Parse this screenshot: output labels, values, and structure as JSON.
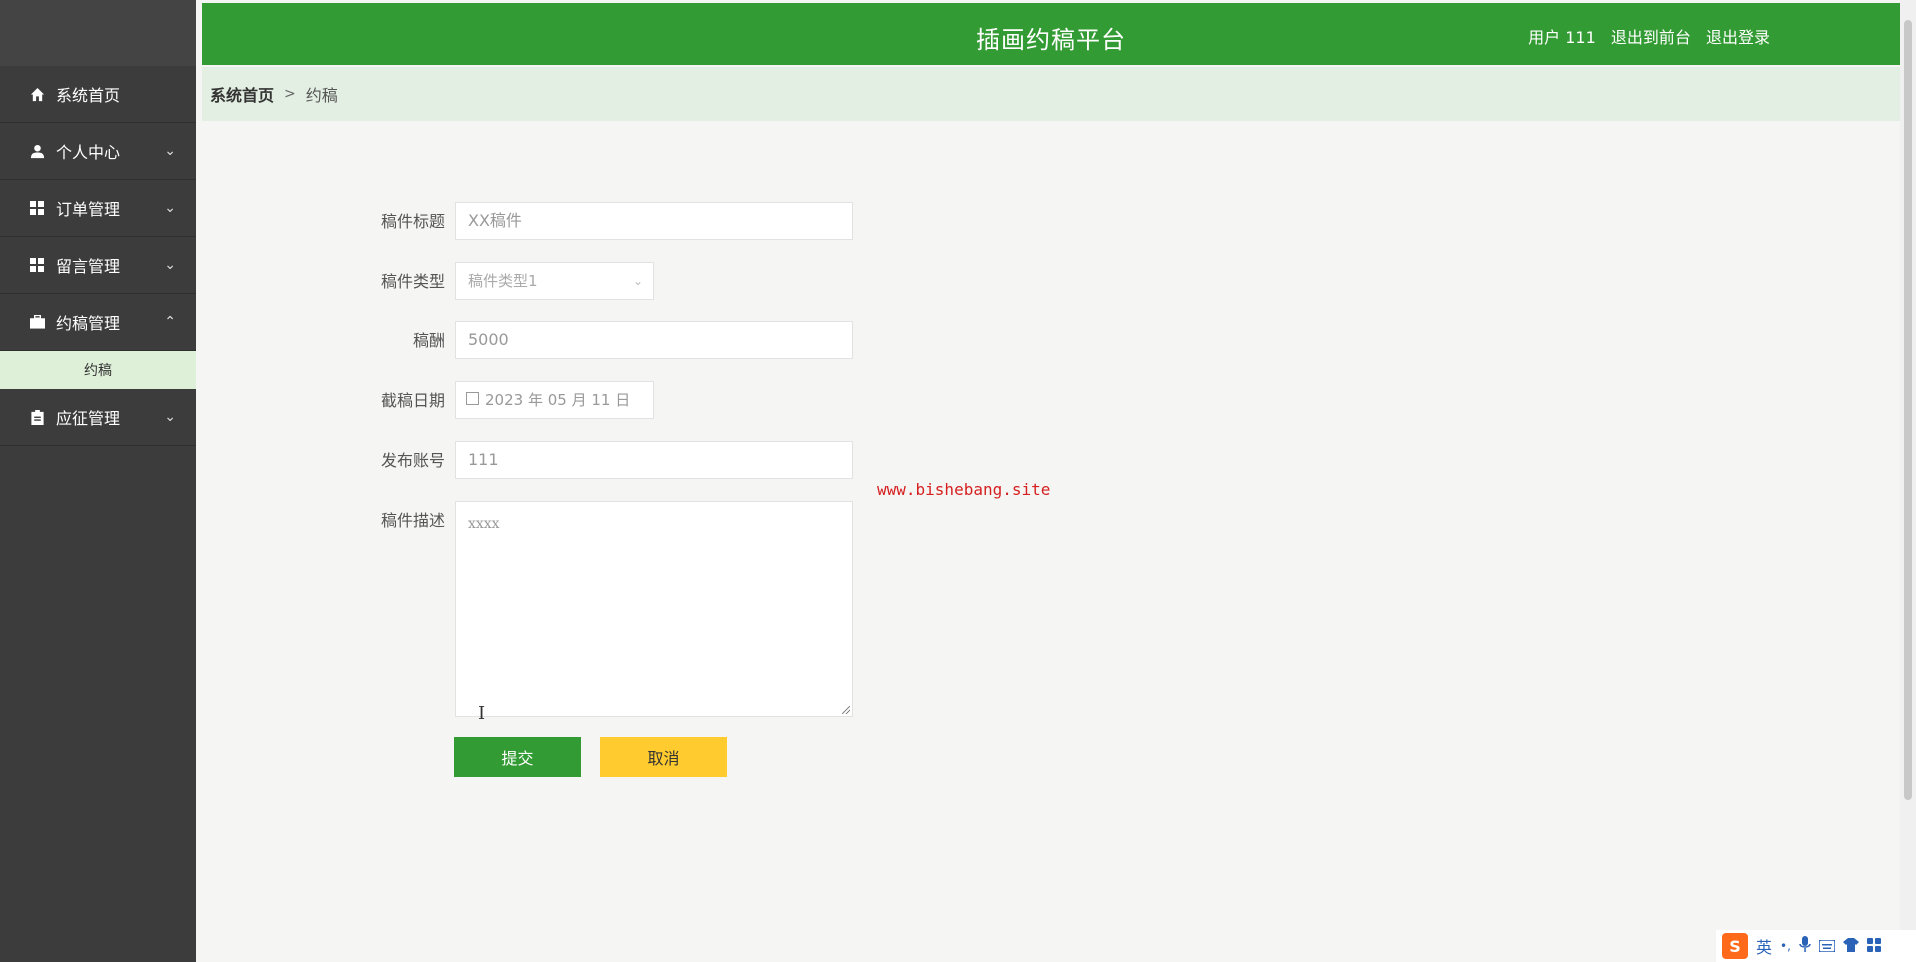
{
  "app": {
    "title": "插画约稿平台"
  },
  "header": {
    "user_label": "用户 111",
    "exit_front": "退出到前台",
    "logout": "退出登录"
  },
  "sidebar": {
    "items": [
      {
        "label": "系统首页",
        "icon": "home-icon"
      },
      {
        "label": "个人中心",
        "icon": "user-icon"
      },
      {
        "label": "订单管理",
        "icon": "grid-icon"
      },
      {
        "label": "留言管理",
        "icon": "grid-icon"
      },
      {
        "label": "约稿管理",
        "icon": "briefcase-icon"
      },
      {
        "label": "应征管理",
        "icon": "clipboard-icon"
      }
    ],
    "sub_item": {
      "label": "约稿"
    }
  },
  "breadcrumb": {
    "home": "系统首页",
    "separator": ">",
    "current": "约稿"
  },
  "form": {
    "title_label": "稿件标题",
    "title_value": "XX稿件",
    "type_label": "稿件类型",
    "type_value": "稿件类型1",
    "fee_label": "稿酬",
    "fee_value": "5000",
    "deadline_label": "截稿日期",
    "deadline_value": "2023 年 05 月 11 日",
    "account_label": "发布账号",
    "account_value": "111",
    "desc_label": "稿件描述",
    "desc_value": "xxxx"
  },
  "buttons": {
    "submit": "提交",
    "cancel": "取消"
  },
  "watermark": "www.bishebang.site",
  "ime": {
    "logo": "S",
    "lang": "英",
    "punct": "•,"
  },
  "colors": {
    "primary": "#339b33",
    "warning": "#ffcb2f",
    "sidebar": "#3c3c3c"
  }
}
